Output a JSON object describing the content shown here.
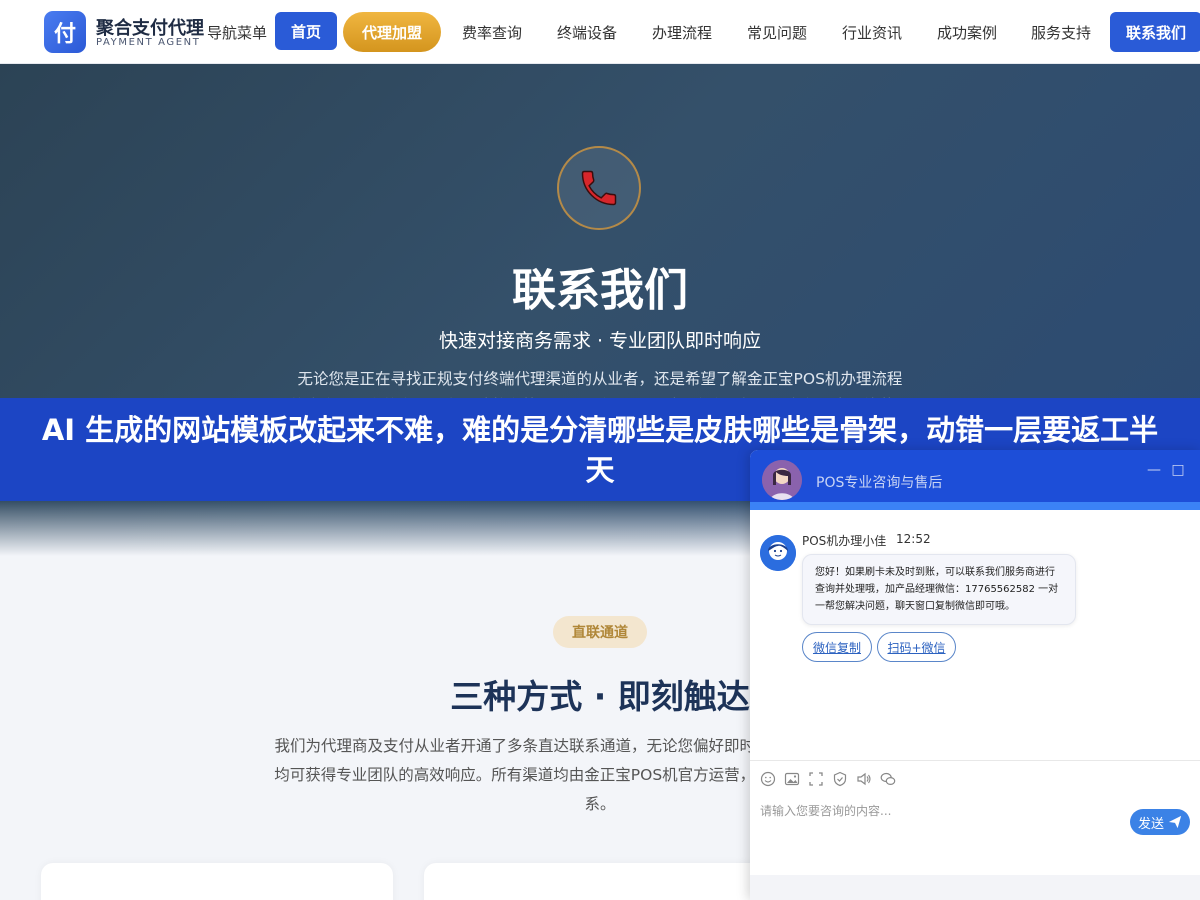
{
  "header": {
    "logo_char": "付",
    "brand_cn": "聚合支付代理",
    "brand_en": "PAYMENT AGENT",
    "nav_menu_label": "导航菜单",
    "home_label": "首页",
    "agent_label": "代理加盟",
    "nav_items": [
      "费率查询",
      "终端设备",
      "办理流程",
      "常见问题",
      "行业资讯",
      "成功案例",
      "服务支持"
    ],
    "contact_label": "联系我们"
  },
  "hero": {
    "title": "联系我们",
    "subtitle": "快速对接商务需求 · 专业团队即时响应",
    "description": "无论您是正在寻找正规支付终端代理渠道的从业者，还是希望了解金正宝POS机办理流程的商户，我们的专业服务团队将在第一时间为您提供一对一咨询。每一个商务需求都能获得及时、准确、专业的回复。"
  },
  "banner": {
    "text": "AI 生成的网站模板改起来不难，难的是分清哪些是皮肤哪些是骨架，动错一层要返工半天"
  },
  "section": {
    "pill": "直联通道",
    "title": "三种方式 · 即刻触达",
    "description": "我们为代理商及支付从业者开通了多条直达联系通道，无论您偏好即时交流还是邮件正式对接，均可获得专业团队的高效响应。所有渠道均由金正宝POS机官方运营，信息真实可靠，请放心联系。"
  },
  "chat": {
    "title": "POS专业咨询与售后",
    "agent_name": "POS机办理小佳",
    "time": "12:52",
    "message": "您好！如果刷卡未及时到账，可以联系我们服务商进行查询并处理哦，加产品经理微信：17765562582 一对一帮您解决问题，聊天窗口复制微信即可哦。",
    "chips": [
      "微信复制",
      "扫码+微信"
    ],
    "input_placeholder": "请输入您要咨询的内容...",
    "send_label": "发送",
    "toolbar_icons": [
      "emoji-icon",
      "image-icon",
      "screenshot-icon",
      "rate-icon",
      "voice-icon",
      "wechat-icon"
    ]
  },
  "colors": {
    "primary": "#2a5bd7",
    "gold": "#d4951e",
    "banner": "#1c45c4",
    "title_dark": "#1d3358"
  }
}
